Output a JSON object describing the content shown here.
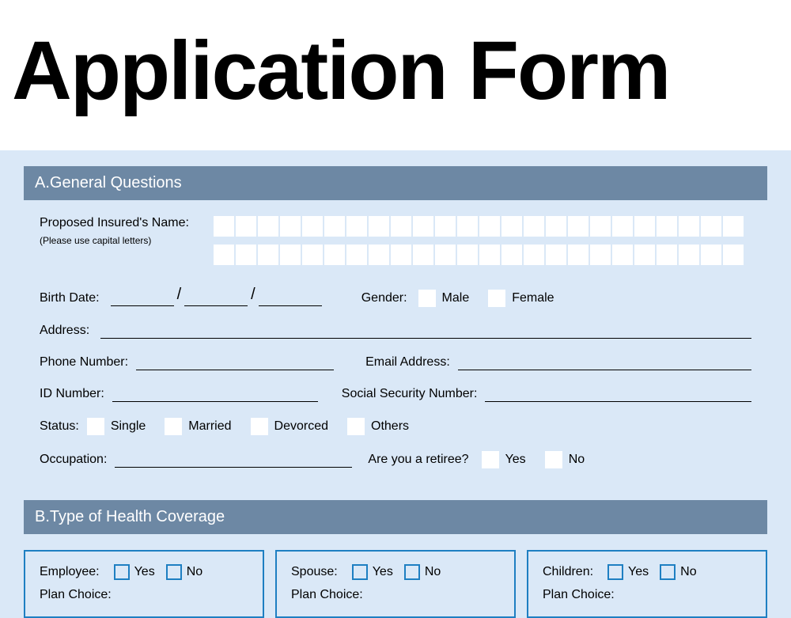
{
  "title": "Application Form",
  "sectionA": {
    "header": "A.General Questions",
    "name": {
      "label": "Proposed Insured's Name:",
      "hint": "(Please use capital letters)"
    },
    "birthDate": {
      "label": "Birth Date:"
    },
    "gender": {
      "label": "Gender:",
      "male": "Male",
      "female": "Female"
    },
    "address": {
      "label": "Address:"
    },
    "phone": {
      "label": "Phone Number:"
    },
    "email": {
      "label": "Email Address:"
    },
    "idNumber": {
      "label": "ID Number:"
    },
    "ssn": {
      "label": "Social Security  Number:"
    },
    "status": {
      "label": "Status:",
      "single": "Single",
      "married": "Married",
      "divorced": "Devorced",
      "others": "Others"
    },
    "occupation": {
      "label": "Occupation:"
    },
    "retiree": {
      "label": "Are you a retiree?",
      "yes": "Yes",
      "no": "No"
    }
  },
  "sectionB": {
    "header": "B.Type of Health Coverage",
    "employee": {
      "label": "Employee:",
      "yes": "Yes",
      "no": "No",
      "plan": "Plan Choice:"
    },
    "spouse": {
      "label": "Spouse:",
      "yes": "Yes",
      "no": "No",
      "plan": "Plan Choice:"
    },
    "children": {
      "label": "Children:",
      "yes": "Yes",
      "no": "No",
      "plan": "Plan Choice:"
    }
  }
}
